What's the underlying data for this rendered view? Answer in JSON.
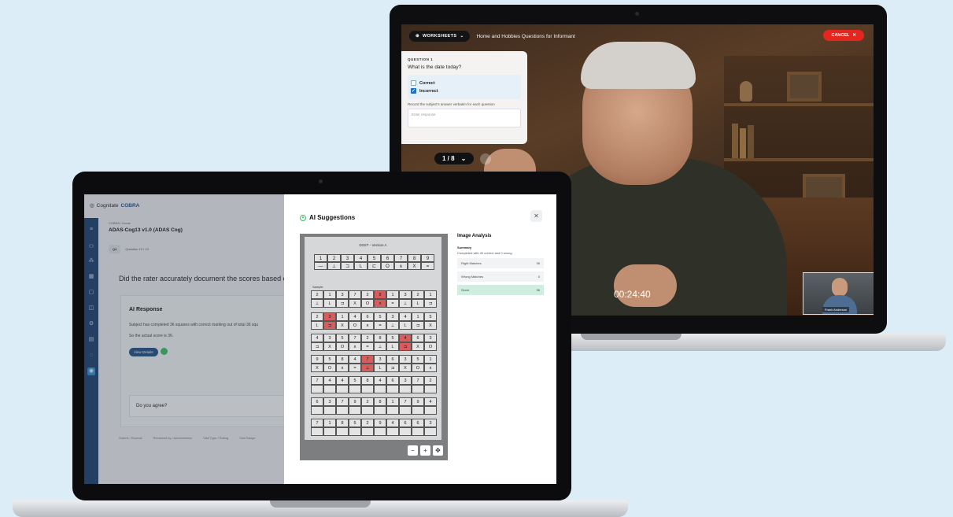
{
  "back": {
    "worksheet_label": "WORKSHEETS",
    "worksheet_title": "Home and Hobbies Questions for Informant",
    "cancel_label": "CANCEL",
    "question_label": "QUESTION 1",
    "question_text": "What is the date today?",
    "options": [
      {
        "label": "Correct",
        "checked": false
      },
      {
        "label": "Incorrect",
        "checked": true
      }
    ],
    "record_hint": "Record the subject's answer verbatim for each question",
    "input_placeholder": "Enter response",
    "page": "1 / 8",
    "timer": "00:24:40",
    "pip_name": "Frank Anderson"
  },
  "front": {
    "brand_prefix": "Cognitate",
    "brand_name": "COBRA",
    "breadcrumb": "COBRA / Home",
    "app_title": "ADAS-Cog13 v1.0 (ADAS Cog)",
    "tool_chip": "Q4",
    "tool_text": "Question 10 / 13",
    "main_question": "Did the rater accurately document the scores based on th",
    "ai_response": {
      "heading": "AI Response",
      "line1": "Subject has completed 36 squares with correct marking out of total 36 squ",
      "line2": "So the actual score is 36.",
      "button": "View Details"
    },
    "agree_text": "Do you agree?",
    "footer": [
      "Submit / Rounds",
      "Reviewed by / Administrator",
      "Visit Type / Rating",
      "Visit Range"
    ],
    "modal": {
      "title": "AI Suggestions",
      "close_icon": "close-icon",
      "scan_title": "DSST - Version A",
      "sample_label": "Sample",
      "key_numbers": [
        "1",
        "2",
        "3",
        "4",
        "5",
        "6",
        "7",
        "8",
        "9"
      ],
      "key_symbols": [
        "—",
        "⊥",
        "⊐",
        "L",
        "⊏",
        "O",
        "∧",
        "X",
        "="
      ],
      "analysis": {
        "title": "Image Analysis",
        "summary_label": "Summary",
        "summary_text": "Completed with 40 correct and 0 wrong",
        "rows": [
          {
            "label": "Right Matches",
            "value": "36"
          },
          {
            "label": "Wrong Matches",
            "value": "0"
          },
          {
            "label": "Score",
            "value": "36"
          }
        ]
      }
    }
  }
}
